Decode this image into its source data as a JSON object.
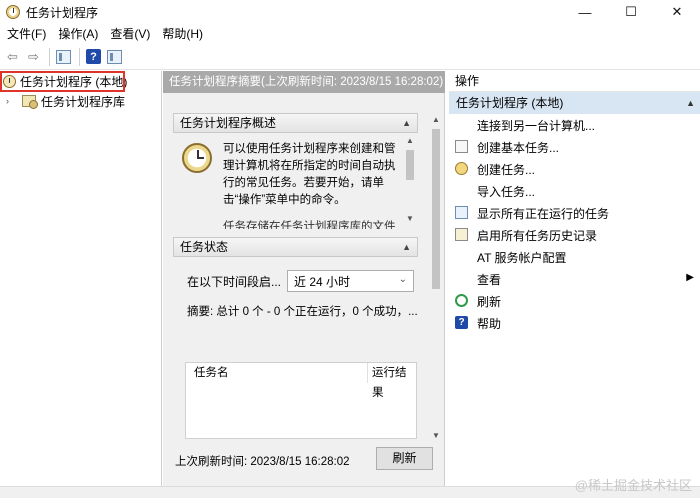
{
  "window": {
    "title": "任务计划程序",
    "minimize": "—",
    "maximize": "☐",
    "close": "✕"
  },
  "menu": [
    "文件(F)",
    "操作(A)",
    "查看(V)",
    "帮助(H)"
  ],
  "toolbar": {
    "back": "⇦",
    "forward": "⇨",
    "help": "?"
  },
  "tree": {
    "root_label": "任务计划程序 (本地)",
    "child_label": "任务计划程序库",
    "child_expander": "›"
  },
  "center": {
    "header": "任务计划程序摘要(上次刷新时间: 2023/8/15 16:28:02)",
    "overview": {
      "title": "任务计划程序概述",
      "text": "可以使用任务计划程序来创建和管理计算机将在所指定的时间自动执行的常见任务。若要开始，请单击“操作”菜单中的命令。",
      "text2": "任务存储在任务计划程序库的文件"
    },
    "status": {
      "title": "任务状态",
      "period_label": "在以下时间段启...",
      "period_value": "近 24 小时",
      "summary": "摘要: 总计 0 个 - 0 个正在运行，0 个成功，...",
      "col_name": "任务名",
      "col_result": "运行结果"
    },
    "last_refresh": "上次刷新时间: 2023/8/15 16:28:02",
    "refresh_button": "刷新"
  },
  "actions": {
    "title": "操作",
    "section": "任务计划程序 (本地)",
    "items": [
      {
        "label": "连接到另一台计算机...",
        "icon": "none-icon"
      },
      {
        "label": "创建基本任务...",
        "icon": "document-icon"
      },
      {
        "label": "创建任务...",
        "icon": "task-icon"
      },
      {
        "label": "导入任务...",
        "icon": "none-icon"
      },
      {
        "label": "显示所有正在运行的任务",
        "icon": "list-icon"
      },
      {
        "label": "启用所有任务历史记录",
        "icon": "history-icon"
      },
      {
        "label": "AT 服务帐户配置",
        "icon": "none-icon"
      },
      {
        "label": "查看",
        "icon": "none-icon",
        "submenu": "▶"
      },
      {
        "label": "刷新",
        "icon": "refresh-icon"
      },
      {
        "label": "帮助",
        "icon": "help-icon"
      }
    ]
  },
  "watermark": "@稀土掘金技术社区"
}
